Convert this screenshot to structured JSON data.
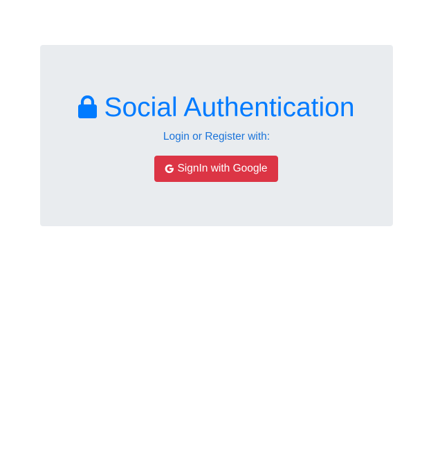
{
  "card": {
    "title": "Social Authentication",
    "subtitle": "Login or Register with:",
    "icon": "lock-icon"
  },
  "google_button": {
    "label": "SignIn with Google",
    "icon": "google-icon"
  },
  "colors": {
    "primary": "#007bff",
    "danger": "#dc3545",
    "jumbotron_bg": "#e9ecef"
  }
}
